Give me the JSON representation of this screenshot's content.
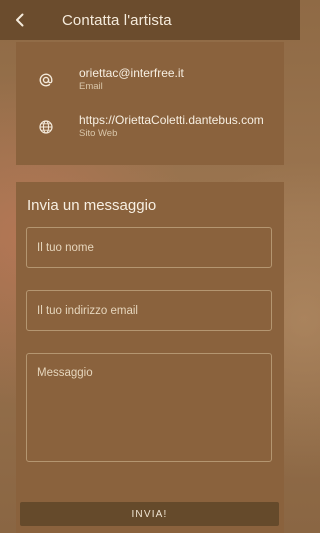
{
  "header": {
    "title": "Contatta l'artista"
  },
  "contacts": [
    {
      "icon": "at-icon",
      "value": "oriettac@interfree.it",
      "label": "Email"
    },
    {
      "icon": "globe-icon",
      "value": "https://OriettaColetti.dantebus.com",
      "label": "Sito Web"
    }
  ],
  "form": {
    "title": "Invia un messaggio",
    "name_placeholder": "Il tuo nome",
    "email_placeholder": "Il tuo indirizzo email",
    "message_placeholder": "Messaggio",
    "submit_label": "INVIA!"
  }
}
